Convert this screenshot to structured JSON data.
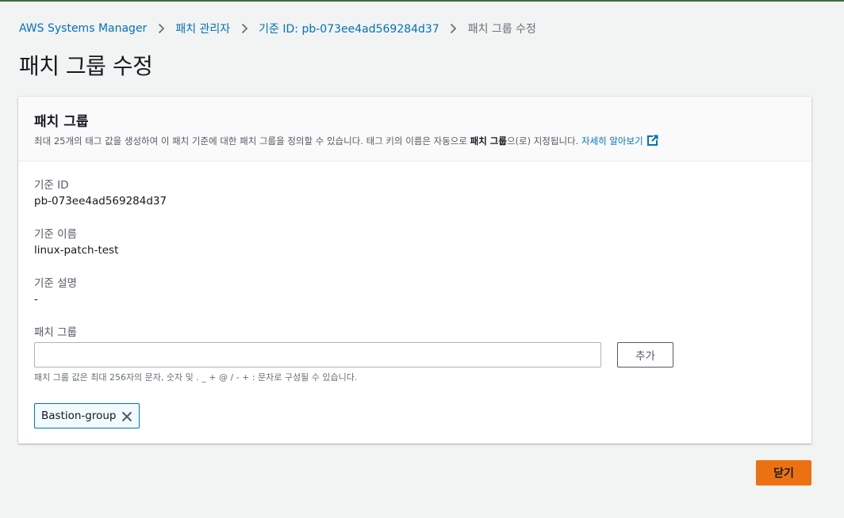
{
  "breadcrumb": {
    "items": [
      "AWS Systems Manager",
      "패치 관리자",
      "기준 ID: pb-073ee4ad569284d37"
    ],
    "current": "패치 그룹 수정"
  },
  "page": {
    "title": "패치 그룹 수정"
  },
  "panel": {
    "title": "패치 그룹",
    "description_prefix": "최대 25개의 태그 값을 생성하여 이 패치 기준에 대한 패치 그룹을 정의할 수 있습니다. 태그 키의 이름은 자동으로 ",
    "description_bold": "패치 그룹",
    "description_suffix": "으(로) 지정됩니다. ",
    "learn_more": "자세히 알아보기"
  },
  "fields": {
    "baseline_id_label": "기준 ID",
    "baseline_id_value": "pb-073ee4ad569284d37",
    "baseline_name_label": "기준 이름",
    "baseline_name_value": "linux-patch-test",
    "baseline_desc_label": "기준 설명",
    "baseline_desc_value": "-",
    "patch_group_label": "패치 그룹",
    "patch_group_value": "",
    "patch_group_placeholder": "",
    "add_label": "추가",
    "hint": "패치 그룹 값은 최대 256자의 문자, 숫자 및 . _ + @ / - + : 문자로 구성될 수 있습니다."
  },
  "tokens": [
    "Bastion-group"
  ],
  "footer": {
    "close_label": "닫기"
  },
  "colors": {
    "link": "#0073bb",
    "primary": "#ec7211",
    "token_border": "#0073bb"
  },
  "icons": {
    "breadcrumb_separator": "chevron-right-icon",
    "external_link": "external-link-icon",
    "token_remove": "close-icon"
  }
}
